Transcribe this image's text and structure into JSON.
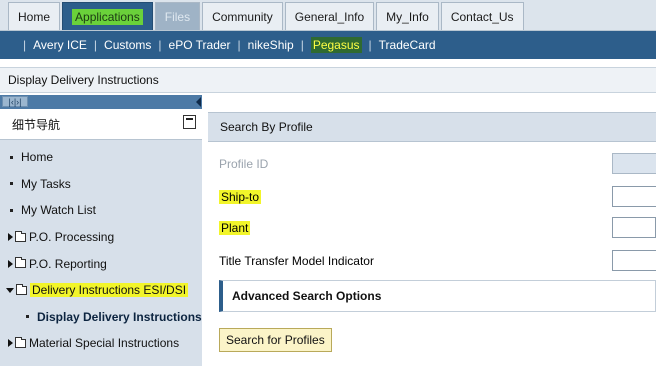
{
  "top_tabs": [
    {
      "label": "Home",
      "state": "normal"
    },
    {
      "label": "Applications",
      "state": "active"
    },
    {
      "label": "Files",
      "state": "disabled"
    },
    {
      "label": "Community",
      "state": "normal"
    },
    {
      "label": "General_Info",
      "state": "normal"
    },
    {
      "label": "My_Info",
      "state": "normal"
    },
    {
      "label": "Contact_Us",
      "state": "normal"
    }
  ],
  "sub_nav": [
    "Avery ICE",
    "Customs",
    "ePO Trader",
    "nikeShip",
    "Pegasus",
    "TradeCard"
  ],
  "sub_nav_highlighted": "Pegasus",
  "page_title": "Display Delivery Instructions",
  "left_panel": {
    "header": "细节导航",
    "items": [
      {
        "label": "Home",
        "type": "bullet"
      },
      {
        "label": "My Tasks",
        "type": "bullet"
      },
      {
        "label": "My Watch List",
        "type": "bullet"
      },
      {
        "label": "P.O. Processing",
        "type": "folder-collapsed"
      },
      {
        "label": "P.O. Reporting",
        "type": "folder-collapsed"
      },
      {
        "label": "Delivery Instructions ESI/DSI",
        "type": "folder-expanded"
      },
      {
        "label": "Display Delivery Instructions",
        "type": "sub-selected"
      },
      {
        "label": "Material Special Instructions",
        "type": "folder-collapsed"
      }
    ]
  },
  "search_form": {
    "section_title": "Search By Profile",
    "fields": [
      {
        "label": "Profile ID",
        "disabled": true
      },
      {
        "label": "Ship-to",
        "highlighted": true
      },
      {
        "label": "Plant",
        "highlighted": true
      },
      {
        "label": "Title Transfer Model Indicator"
      }
    ],
    "advanced_options": "Advanced Search Options",
    "search_button": "Search for Profiles"
  },
  "colors": {
    "nav_blue": "#2d5e8b",
    "highlight_yellow": "#f2f52a",
    "highlight_green": "#6ad13a"
  }
}
